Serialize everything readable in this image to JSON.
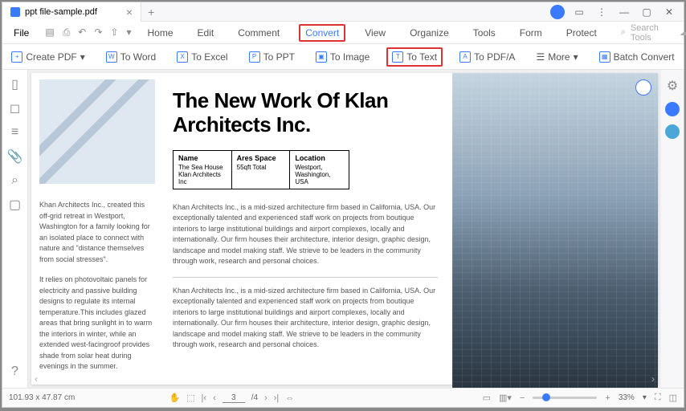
{
  "titlebar": {
    "tab_name": "ppt file-sample.pdf"
  },
  "menu": {
    "file": "File",
    "tabs": [
      "Home",
      "Edit",
      "Comment",
      "Convert",
      "View",
      "Organize",
      "Tools",
      "Form",
      "Protect"
    ],
    "active_tab": "Convert",
    "search_placeholder": "Search Tools"
  },
  "ribbon": {
    "create_pdf": "Create PDF",
    "to_word": "To Word",
    "to_excel": "To Excel",
    "to_ppt": "To PPT",
    "to_image": "To Image",
    "to_text": "To Text",
    "to_pdfa": "To PDF/A",
    "more": "More",
    "batch": "Batch Convert"
  },
  "document": {
    "headline": "The New Work Of Klan Architects Inc.",
    "table": {
      "name_head": "Name",
      "name_val": "The Sea House Klan Architects Inc",
      "area_head": "Ares Space",
      "area_val": "55qft Total",
      "loc_head": "Location",
      "loc_val": "Westport, Washington, USA"
    },
    "left_p1": "Khan Architects Inc., created this off-grid retreat in Westport, Washington for a family looking for an isolated place to connect with nature and \"distance themselves from social stresses\".",
    "left_p2": "It relies on photovoltaic panels for electricity and passive building designs to regulate its internal temperature.This includes glazed areas that bring sunlight in to warm the interiors in winter, while an extended west-facingroof provides shade from solar heat during evenings in the summer.",
    "mid_p": "Khan Architects Inc., is a mid-sized architecture firm based in California, USA. Our exceptionally talented and experienced staff work on projects from boutique interiors to large institutional buildings and airport complexes, locally and internationally. Our firm houses their architecture, interior design, graphic design, landscape and model making staff. We strieve to be leaders in the community through work, research and personal choices."
  },
  "status": {
    "dimensions": "101.93 x 47.87 cm",
    "page_current": "3",
    "page_total": "/4",
    "zoom": "33%"
  }
}
